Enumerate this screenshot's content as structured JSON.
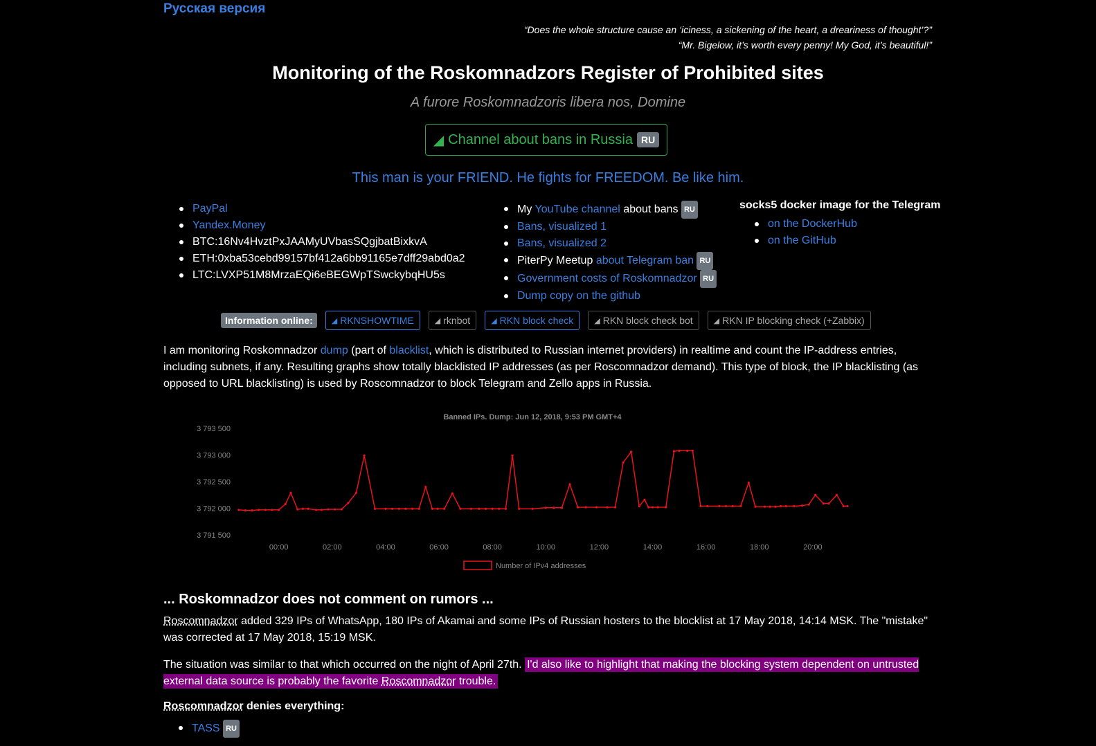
{
  "lang_link": "Русская версия",
  "quotes": [
    "“Does the whole structure cause an ‘iciness, a sickening of the heart, a dreariness of thought’?”",
    "“Mr. Bigelow, it’s worth every penny! My God, it’s beautiful!”"
  ],
  "title": "Monitoring of the Roskomnadzors Register of Prohibited sites",
  "subtitle": "A furore Roskomnadzoris libera nos, Domine",
  "channel_button": {
    "label": "Channel about bans in Russia",
    "badge": "RU"
  },
  "friend_text": "This man is your FRIEND. He fights for FREEDOM. Be like him.",
  "donate": {
    "paypal": "PayPal",
    "yandex": "Yandex.Money",
    "btc": "BTC:16Nv4HvztPxJAAMyUVbasSQgjbatBixkvA",
    "eth": "ETH:0xba53cebd99157bf412a6bb91165e7dff29abd0a2",
    "ltc": "LTC:LVXP51M8MrzaEQi6eBEGWpTSwckybqHU5s"
  },
  "links": {
    "youtube_prefix": "My",
    "youtube_link": "YouTube channel",
    "youtube_suffix": "about bans",
    "ru": "RU",
    "bans1": "Bans, visualized 1",
    "bans2": "Bans, visualized 2",
    "piterpy_prefix": "PiterPy Meetup",
    "piterpy_link": "about Telegram ban",
    "gov": "Government costs of Roskomnadzor",
    "dump": "Dump copy on the github"
  },
  "socks": {
    "heading": "socks5 docker image for the Telegram",
    "dockerhub": "on the DockerHub",
    "github": "on the GitHub"
  },
  "info": {
    "label": "Information online:",
    "buttons": [
      "RKNSHOWTIME",
      "rknbot",
      "RKN block check",
      "RKN block check bot",
      "RKN IP blocking check (+Zabbix)"
    ]
  },
  "intro": {
    "a": "I am monitoring Roskomnadzor",
    "dump_link": "dump",
    "b": "(part of",
    "blacklist_link": "blacklist",
    "c": ", which is distributed to Russian internet providers) in realtime and count the IP-address entries, including subnets, if any. Resulting graphs show totally blacklisted IP addresses (as per Roscomnadzor demand). This type of block, the IP blacklisting (as opposed to URL blacklisting) is used by Roscomnadzor to block Telegram and Zello apps in Russia."
  },
  "chart_data": {
    "type": "line",
    "title": "Banned IPs. Dump: Jun 12, 2018, 9:53 PM GMT+4",
    "legend": "Number of IPv4 addresses",
    "y_tick_labels": [
      "3 793 500",
      "3 793 000",
      "3 792 500",
      "3 792 000",
      "3 791 500"
    ],
    "x_tick_labels": [
      "00:00",
      "02:00",
      "04:00",
      "06:00",
      "08:00",
      "10:00",
      "12:00",
      "14:00",
      "16:00",
      "18:00",
      "20:00"
    ],
    "ylim": [
      3791500,
      3793500
    ],
    "xlim": [
      -1.6,
      22
    ],
    "color": "#e8131c",
    "x": [
      -1.5,
      -1.25,
      -1.0,
      -0.75,
      -0.5,
      -0.25,
      0.0,
      0.25,
      0.45,
      0.7,
      0.9,
      1.1,
      1.4,
      1.6,
      1.85,
      2.1,
      2.35,
      2.6,
      2.9,
      3.2,
      3.6,
      4.0,
      4.25,
      4.5,
      4.75,
      5.0,
      5.25,
      5.5,
      5.75,
      5.95,
      6.2,
      6.5,
      6.8,
      7.2,
      7.5,
      7.75,
      8.0,
      8.25,
      8.5,
      8.75,
      9.0,
      9.5,
      10.0,
      10.3,
      10.6,
      10.9,
      11.2,
      11.5,
      11.9,
      12.3,
      12.6,
      12.9,
      13.2,
      13.5,
      13.7,
      13.85,
      14.0,
      14.2,
      14.5,
      14.8,
      15.0,
      15.3,
      15.5,
      15.8,
      16.05,
      16.5,
      16.75,
      17.0,
      17.3,
      17.6,
      17.85,
      18.2,
      18.4,
      18.6,
      18.8,
      19.0,
      19.3,
      19.6,
      19.85,
      20.1,
      20.4,
      20.6,
      20.9,
      21.15,
      21.3
    ],
    "values": [
      3791970,
      3791960,
      3791960,
      3791970,
      3791970,
      3791970,
      3791970,
      3792080,
      3792290,
      3791980,
      3791990,
      3791990,
      3791970,
      3791970,
      3791980,
      3791980,
      3791980,
      3792100,
      3792290,
      3792990,
      3791990,
      3791990,
      3791990,
      3791990,
      3791990,
      3791990,
      3791990,
      3792400,
      3791990,
      3791990,
      3791990,
      3792280,
      3791990,
      3791990,
      3791990,
      3791990,
      3791990,
      3791990,
      3791990,
      3792990,
      3791990,
      3791990,
      3792010,
      3792010,
      3792010,
      3792450,
      3792020,
      3792020,
      3792020,
      3792020,
      3792020,
      3792860,
      3793060,
      3792040,
      3792160,
      3792020,
      3792020,
      3792020,
      3792020,
      3793070,
      3793080,
      3793080,
      3793080,
      3792040,
      3792040,
      3792040,
      3792040,
      3792040,
      3792040,
      3792480,
      3792030,
      3792030,
      3792030,
      3792030,
      3792040,
      3792040,
      3792040,
      3792050,
      3792070,
      3792250,
      3792090,
      3792090,
      3792250,
      3792040,
      3792040
    ]
  },
  "rumors_heading": "... Roskomnadzor does not comment on rumors ...",
  "p1": {
    "abbr": "Roscomnadzor",
    "text": "added 329 IPs of WhatsApp, 180 IPs of Akamai and some IPs of Russian hosters to the blocklist at 17 May 2018, 14:14 MSK. The \"mistake\" was corrected at 17 May 2018, 15:19 MSK."
  },
  "p2": {
    "a": "The situation was similar to that which occurred on the night of April 27th.",
    "hl_a": "I'd also like to highlight that making the blocking system dependent on untrusted external data source is probably the favorite",
    "hl_abbr": "Roscomnadzor",
    "hl_b": "trouble."
  },
  "p3": {
    "abbr": "Roscomnadzor",
    "text": "denies everything:"
  },
  "tass": {
    "label": "TASS",
    "badge": "RU"
  },
  "colors": {
    "link": "#3a7fe0",
    "green": "#33b24f",
    "highlight": "#800080",
    "badge": "#6c757d"
  }
}
